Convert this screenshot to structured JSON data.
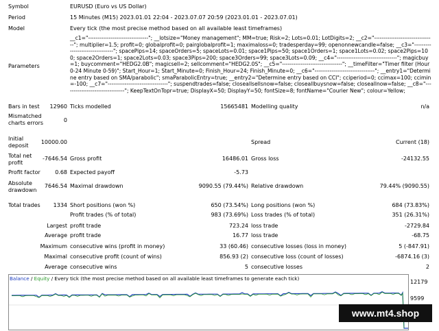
{
  "header": {
    "symbol_label": "Symbol",
    "symbol_value": "EURUSD (Euro vs US Dollar)",
    "period_label": "Period",
    "period_value": "15 Minutes (M15) 2023.01.01 22:04 - 2023.07.07 20:59 (2023.01.01 - 2023.07.01)",
    "model_label": "Model",
    "model_value": "Every tick (the most precise method based on all available least timeframes)",
    "parameters_label": "Parameters",
    "parameters_value": "__c1=\"--------------------------------\"; __lotsize=\"Money management\"; MM=true; Risk=2; Lots=0.01; LotDigits=2; __c2=\"--------------------------------\"; multiplier=1.5; profit=0; globalprofit=0; pairglobalprofit=1; maximaloss=0; tradesperday=99; openonnewcandle=false; __c3=\"--------------------------------\"; spacePips=14; spaceOrders=5; spaceLots=0.01; space1Pips=50; space1Orders=1; space1Lots=0.02; space2Pips=100; space2Orders=1; space2Lots=0.03; space3Pips=200; space3Orders=99; space3Lots=0.09; __c4=\"--------------------------------\"; magicbuy=1; buycomment=\"HEDG2.0B\"; magicsell=2; sellcomment=\"HEDG2.0S\"; __c5=\"--------------------------------\"; __timeFilter=\"Timer filter (Hour 0-24 Minute 0-59)\"; Start_Hour=1; Start_Minute=0; Finish_Hour=24; Finish_Minute=0; __c6=\"--------------------------------\"; __entry1=\"Determine entry based on SMA/parabolic\"; smaParabolicEntry=true; __entry2=\"Determine entry based on CCI\"; cciperiod=0; ccimax=100; ccimin=-100; __c7=\"--------------------------------\"; suspendtrades=false; closeallsellsnow=false; closeallbuysnow=false; closeallnow=false; __c8=\"--------------------------------\"; KeepTextOnTopr=true; DisplayX=50; DisplayY=50; fontSize=8; fontName=\"Courier New\"; colour=Yellow;"
  },
  "stats": {
    "bars_label": "Bars in test",
    "bars_value": "12960",
    "ticks_label": "Ticks modelled",
    "ticks_value": "15665481",
    "quality_label": "Modelling quality",
    "quality_value": "n/a",
    "mismatch_label": "Mismatched charts errors",
    "mismatch_value": "0",
    "initial_label": "Initial deposit",
    "initial_value": "10000.00",
    "spread_label": "Spread",
    "spread_value": "Current (18)",
    "net_label": "Total net profit",
    "net_value": "-7646.54",
    "gross_profit_label": "Gross profit",
    "gross_profit_value": "16486.01",
    "gross_loss_label": "Gross loss",
    "gross_loss_value": "-24132.55",
    "pf_label": "Profit factor",
    "pf_value": "0.68",
    "payoff_label": "Expected payoff",
    "payoff_value": "-5.73",
    "abs_dd_label": "Absolute drawdown",
    "abs_dd_value": "7646.54",
    "max_dd_label": "Maximal drawdown",
    "max_dd_value": "9090.55 (79.44%)",
    "rel_dd_label": "Relative drawdown",
    "rel_dd_value": "79.44% (9090.55)",
    "trades_label": "Total trades",
    "trades_value": "1334",
    "short_label": "Short positions (won %)",
    "short_value": "650 (73.54%)",
    "long_label": "Long positions (won %)",
    "long_value": "684 (73.83%)",
    "pt_label": "Profit trades (% of total)",
    "pt_value": "983 (73.69%)",
    "lt_label": "Loss trades (% of total)",
    "lt_value": "351 (26.31%)",
    "largest_label": "Largest",
    "largest_pt_label": "profit trade",
    "largest_pt_value": "723.24",
    "largest_lt_label": "loss trade",
    "largest_lt_value": "-2729.84",
    "average_label": "Average",
    "average_pt_label": "profit trade",
    "average_pt_value": "16.77",
    "average_lt_label": "loss trade",
    "average_lt_value": "-68.75",
    "maximum_label": "Maximum",
    "max_cw_label": "consecutive wins (profit in money)",
    "max_cw_value": "33 (60.46)",
    "max_cl_label": "consecutive losses (loss in money)",
    "max_cl_value": "5 (-847.91)",
    "maximal_label": "Maximal",
    "maximal_cp_label": "consecutive profit (count of wins)",
    "maximal_cp_value": "856.93 (2)",
    "maximal_cls_label": "consecutive loss (count of losses)",
    "maximal_cls_value": "-6874.16 (3)",
    "average2_label": "Average",
    "avg_cw_label": "consecutive wins",
    "avg_cw_value": "5",
    "avg_cl_label": "consecutive losses",
    "avg_cl_value": "2"
  },
  "graph": {
    "balance_label": "Balance",
    "slash": " / ",
    "equity_label": "Equity",
    "title_rest": " / Every tick (the most precise method based on all available least timeframes to generate each tick)",
    "y_top": "12179",
    "y_mid": "9599",
    "balance_color": "#1f3fbf",
    "equity_color": "#2a9a2a"
  },
  "watermark": "www.mt4.shop"
}
